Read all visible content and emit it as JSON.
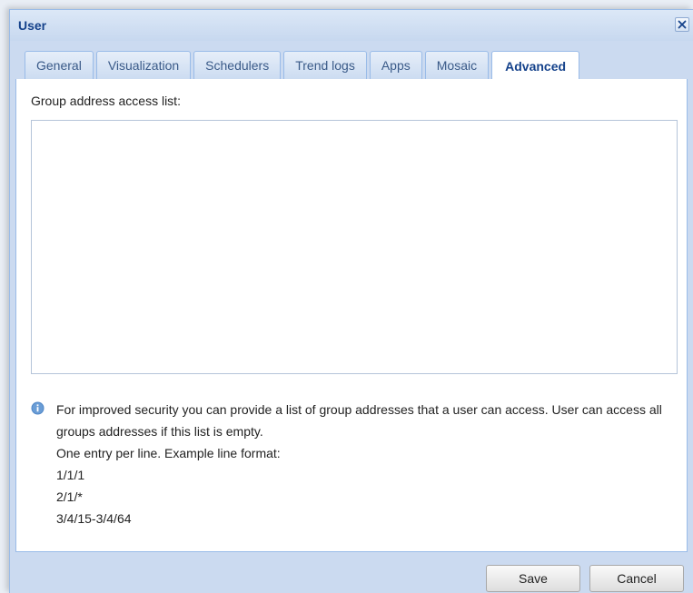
{
  "window": {
    "title": "User"
  },
  "tabs": [
    {
      "label": "General",
      "active": false
    },
    {
      "label": "Visualization",
      "active": false
    },
    {
      "label": "Schedulers",
      "active": false
    },
    {
      "label": "Trend logs",
      "active": false
    },
    {
      "label": "Apps",
      "active": false
    },
    {
      "label": "Mosaic",
      "active": false
    },
    {
      "label": "Advanced",
      "active": true
    }
  ],
  "advanced": {
    "field_label": "Group address access list:",
    "access_list_value": "",
    "help_text": "For improved security you can provide a list of group addresses that a user can access. User can access all groups addresses if this list is empty.",
    "format_note": "One entry per line. Example line format:",
    "examples": [
      "1/1/1",
      "2/1/*",
      "3/4/15-3/4/64"
    ]
  },
  "footer": {
    "save_label": "Save",
    "cancel_label": "Cancel"
  },
  "icons": {
    "close": "close-icon",
    "info": "info-icon"
  },
  "colors": {
    "title_text": "#15428b",
    "frame_background": "#cbdaf0",
    "border": "#99bbe8",
    "info_icon": "#4f86c6"
  }
}
